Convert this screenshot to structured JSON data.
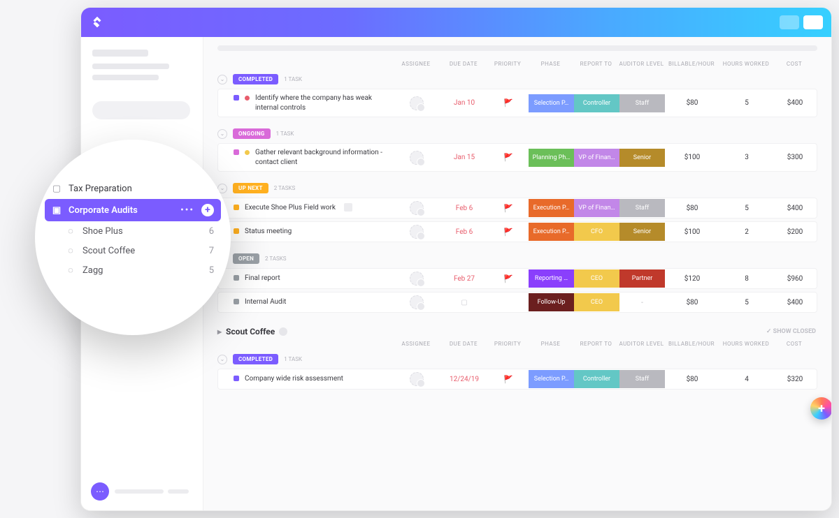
{
  "columns": {
    "assignee": "ASSIGNEE",
    "due": "DUE DATE",
    "priority": "PRIORITY",
    "phase": "PHASE",
    "report": "REPORT TO",
    "auditor": "AUDITOR LEVEL",
    "billable": "BILLABLE/HOUR",
    "hours": "HOURS WORKED",
    "cost": "COST"
  },
  "colors": {
    "completed": "#7b5cff",
    "ongoing": "#d96ad9",
    "upnext": "#ffb020",
    "open": "#9aa0a6",
    "selection": "#7c9cff",
    "controller": "#63c7c5",
    "staff": "#b9b9bf",
    "planning": "#6bbf59",
    "vpfin": "#c287e8",
    "senior": "#b58b2a",
    "execution": "#e86a2a",
    "cfo": "#f2c94c",
    "reporting": "#8a3ffc",
    "ceo": "#f2c94c",
    "partner": "#c0392b",
    "followup": "#6b1f1f"
  },
  "groups": [
    {
      "status": "COMPLETED",
      "status_key": "completed",
      "count": "1 TASK",
      "tasks": [
        {
          "sq": "#7b5cff",
          "bullet": "#e85d6c",
          "title": "Identify where the company has weak internal controls",
          "due": "Jan 10",
          "flag": "🚩",
          "flagc": "#f2c94c",
          "phase": "Selection P…",
          "phase_k": "selection",
          "report": "Controller",
          "report_k": "controller",
          "auditor": "Staff",
          "auditor_k": "staff",
          "billable": "$80",
          "hours": "5",
          "cost": "$400"
        }
      ]
    },
    {
      "status": "ONGOING",
      "status_key": "ongoing",
      "count": "1 TASK",
      "tasks": [
        {
          "sq": "#d96ad9",
          "bullet": "#f2c94c",
          "title": "Gather relevant background information - contact client",
          "due": "Jan 15",
          "flag": "🚩",
          "flagc": "#8fbff5",
          "phase": "Planning Ph…",
          "phase_k": "planning",
          "report": "VP of Finan…",
          "report_k": "vpfin",
          "auditor": "Senior",
          "auditor_k": "senior",
          "billable": "$100",
          "hours": "3",
          "cost": "$300"
        }
      ]
    },
    {
      "status": "UP NEXT",
      "status_key": "upnext",
      "count": "2 TASKS",
      "tasks": [
        {
          "sq": "#ffb020",
          "bullet": "",
          "title": "Execute Shoe Plus Field work",
          "due": "Feb 6",
          "flag": "🚩",
          "flagc": "#8fbff5",
          "phase": "Execution P…",
          "phase_k": "execution",
          "report": "VP of Finan…",
          "report_k": "vpfin",
          "auditor": "Staff",
          "auditor_k": "staff",
          "billable": "$80",
          "hours": "5",
          "cost": "$400",
          "extra_box": true
        },
        {
          "sq": "#ffb020",
          "bullet": "",
          "title": "Status meeting",
          "due": "Feb 6",
          "flag": "🚩",
          "flagc": "#8fbff5",
          "phase": "Execution P…",
          "phase_k": "execution",
          "report": "CFO",
          "report_k": "cfo",
          "auditor": "Senior",
          "auditor_k": "senior",
          "billable": "$100",
          "hours": "2",
          "cost": "$200"
        }
      ]
    },
    {
      "status": "OPEN",
      "status_key": "open",
      "count": "2 TASKS",
      "tasks": [
        {
          "sq": "#9aa0a6",
          "bullet": "",
          "title": "Final report",
          "due": "Feb 27",
          "flag": "🚩",
          "flagc": "#c0392b",
          "phase": "Reporting …",
          "phase_k": "reporting",
          "report": "CEO",
          "report_k": "ceo",
          "auditor": "Partner",
          "auditor_k": "partner",
          "billable": "$120",
          "hours": "8",
          "cost": "$960"
        },
        {
          "sq": "#9aa0a6",
          "bullet": "",
          "title": "Internal Audit",
          "due": "",
          "due_icon": true,
          "flag": "",
          "flagc": "",
          "phase": "Follow-Up",
          "phase_k": "followup",
          "report": "CEO",
          "report_k": "ceo",
          "auditor": "-",
          "auditor_k": "",
          "billable": "$80",
          "hours": "5",
          "cost": "$400"
        }
      ]
    }
  ],
  "section2": {
    "name": "Scout Coffee",
    "show_closed": "✓ SHOW CLOSED",
    "group": {
      "status": "COMPLETED",
      "status_key": "completed",
      "count": "1 TASK",
      "tasks": [
        {
          "sq": "#7b5cff",
          "bullet": "",
          "title": "Company wide risk assessment",
          "due": "12/24/19",
          "flag": "🚩",
          "flagc": "#f2c94c",
          "phase": "Selection P…",
          "phase_k": "selection",
          "report": "Controller",
          "report_k": "controller",
          "auditor": "Staff",
          "auditor_k": "staff",
          "billable": "$80",
          "hours": "4",
          "cost": "$320"
        }
      ]
    }
  },
  "popover": {
    "folders": [
      {
        "name": "Tax Preparation",
        "active": false
      },
      {
        "name": "Corporate Audits",
        "active": true
      }
    ],
    "lists": [
      {
        "name": "Shoe Plus",
        "count": "6"
      },
      {
        "name": "Scout Coffee",
        "count": "7"
      },
      {
        "name": "Zagg",
        "count": "5"
      }
    ]
  }
}
